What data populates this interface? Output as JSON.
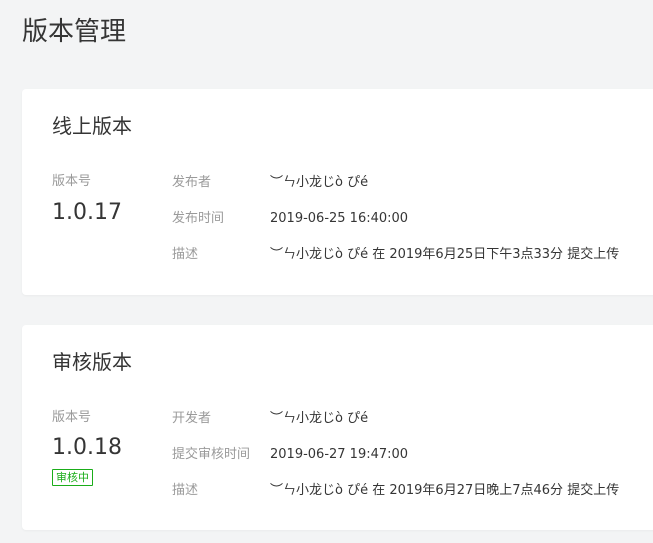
{
  "page": {
    "title": "版本管理"
  },
  "online": {
    "title": "线上版本",
    "version_label": "版本号",
    "version": "1.0.17",
    "rows": [
      {
        "label": "发布者",
        "value": "︶ㄣ小龙じò ぴé"
      },
      {
        "label": "发布时间",
        "value": "2019-06-25 16:40:00"
      },
      {
        "label": "描述",
        "value": "︶ㄣ小龙じò ぴé 在 2019年6月25日下午3点33分 提交上传"
      }
    ]
  },
  "review": {
    "title": "审核版本",
    "version_label": "版本号",
    "version": "1.0.18",
    "status": "审核中",
    "rows": [
      {
        "label": "开发者",
        "value": "︶ㄣ小龙じò ぴé"
      },
      {
        "label": "提交审核时间",
        "value": "2019-06-27 19:47:00"
      },
      {
        "label": "描述",
        "value": "︶ㄣ小龙じò ぴé 在 2019年6月27日晚上7点46分 提交上传"
      }
    ]
  },
  "colors": {
    "background": "#f3f4f5",
    "card": "#ffffff",
    "text": "#353535",
    "muted": "#9a9a9a",
    "status_green": "#1aad19"
  }
}
